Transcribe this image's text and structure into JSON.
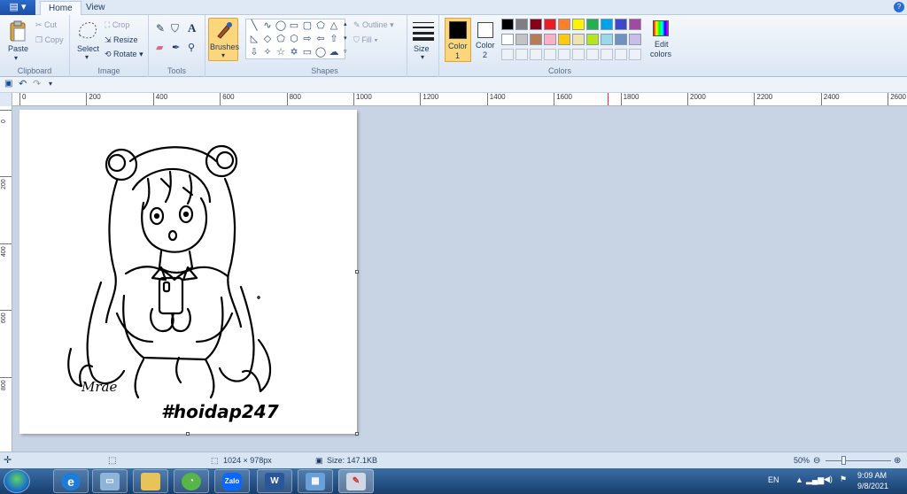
{
  "tabs": {
    "home": "Home",
    "view": "View"
  },
  "clipboard": {
    "paste": "Paste",
    "cut": "Cut",
    "copy": "Copy",
    "group": "Clipboard"
  },
  "image": {
    "select": "Select",
    "crop": "Crop",
    "resize": "Resize",
    "rotate": "Rotate",
    "group": "Image"
  },
  "tools": {
    "text_glyph": "A",
    "group": "Tools"
  },
  "brushes": {
    "label": "Brushes"
  },
  "shapes": {
    "outline": "Outline",
    "fill": "Fill",
    "group": "Shapes"
  },
  "size": {
    "label": "Size"
  },
  "colors": {
    "color1_label": "Color",
    "color1_num": "1",
    "color2_label": "Color",
    "color2_num": "2",
    "edit_label": "Edit",
    "edit_label2": "colors",
    "group": "Colors",
    "color1": "#000000",
    "color2": "#ffffff",
    "row1": [
      "#000000",
      "#7f7f7f",
      "#880015",
      "#ed1c24",
      "#ff7f27",
      "#fff200",
      "#22b14c",
      "#00a2e8",
      "#3f48cc",
      "#a349a4"
    ],
    "row2": [
      "#ffffff",
      "#c3c3c3",
      "#b97a57",
      "#ffaec9",
      "#ffc90e",
      "#efe4b0",
      "#b5e61d",
      "#99d9ea",
      "#7092be",
      "#c8bfe7"
    ]
  },
  "ruler": {
    "ticks": [
      "0",
      "200",
      "400",
      "600",
      "800",
      "1000",
      "1200",
      "1400",
      "1600",
      "1800",
      "2000",
      "2200",
      "2400",
      "2600"
    ]
  },
  "vruler": {
    "ticks": [
      "0",
      "200",
      "400",
      "600",
      "800"
    ]
  },
  "drawing": {
    "signature": "#hoidap247",
    "scribble": "Mrae"
  },
  "status": {
    "dimensions": "1024 × 978px",
    "filesize": "Size: 147.1KB",
    "zoom": "50%"
  },
  "tray": {
    "lang": "EN",
    "time": "9:09 AM",
    "date": "9/8/2021"
  },
  "taskbar": {
    "zalo": "Zalo",
    "word": "W"
  }
}
